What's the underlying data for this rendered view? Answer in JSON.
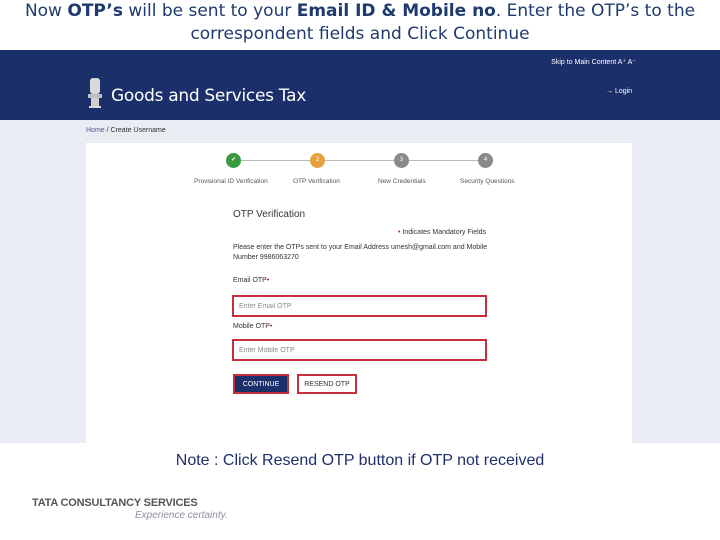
{
  "slide": {
    "heading_parts": {
      "p1": "Now ",
      "p2": "OTP’s",
      "p3": " will be sent to your ",
      "p4": "Email ID & Mobile no",
      "p5": ". Enter the OTP’s to the correspondent fields and Click Continue"
    },
    "note": "Note : Click Resend OTP button if OTP not received",
    "footer": {
      "logo_text": "TATA CONSULTANCY SERVICES",
      "tagline": "Experience certainty."
    }
  },
  "portal": {
    "top_links": "Skip to Main Content  A⁺  A⁻",
    "title": "Goods and Services Tax",
    "login": "→ Login",
    "breadcrumb": {
      "home": "Home",
      "sep": " / ",
      "current": "Create Username"
    },
    "steps": [
      {
        "marker": "✔",
        "label": "Provisional ID Verification",
        "color": "#3a9b3e"
      },
      {
        "marker": "2",
        "label": "OTP Verification",
        "color": "#e8a13a"
      },
      {
        "marker": "3",
        "label": "New Credentials",
        "color": "#8a8a8a"
      },
      {
        "marker": "4",
        "label": "Security Questions",
        "color": "#8a8a8a"
      }
    ],
    "form": {
      "title": "OTP Verification",
      "mandatory_star": "•",
      "mandatory": " Indicates Mandatory Fields",
      "instruction": "Please enter the OTPs sent to your Email Address umesh@gmail.com and Mobile Number 9986063270",
      "email_label": "Email OTP",
      "email_placeholder": "Enter Email OTP",
      "mobile_label": "Mobile OTP",
      "mobile_placeholder": "Enter Mobile OTP",
      "required_mark": "•",
      "continue": "CONTINUE",
      "resend": "RESEND OTP"
    }
  },
  "colors": {
    "navy": "#1b2f6b",
    "highlight_border": "#c6303a"
  }
}
